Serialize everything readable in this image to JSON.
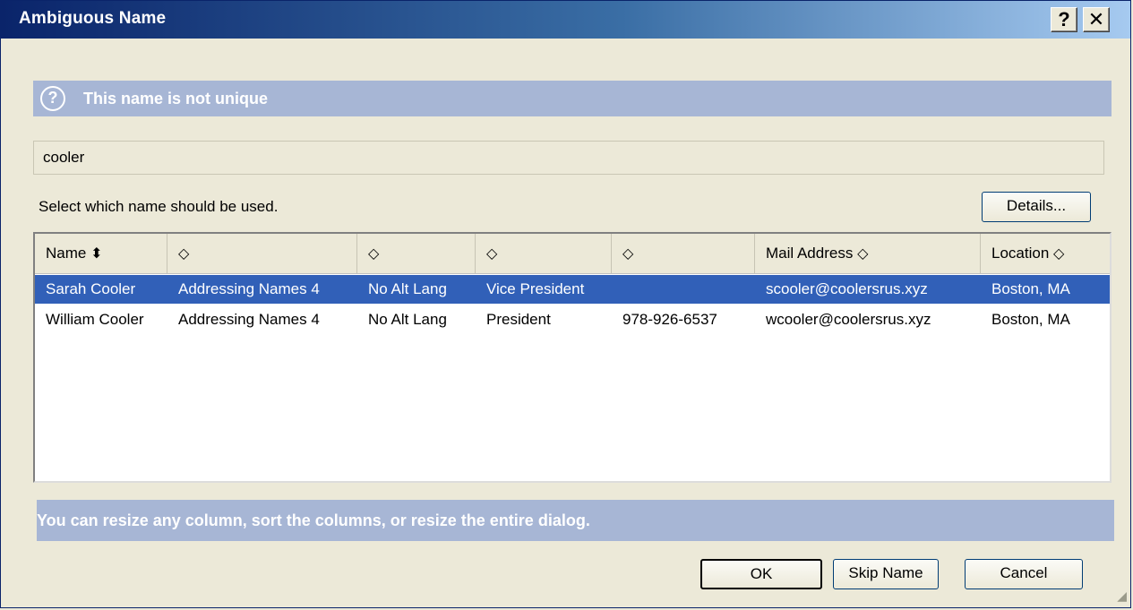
{
  "window": {
    "title": "Ambiguous Name",
    "help_label": "?",
    "close_label": "✕"
  },
  "banner": {
    "icon": "?",
    "text": "This name is not unique"
  },
  "search_value": "cooler",
  "instruction": "Select which name should be used.",
  "buttons": {
    "details": "Details...",
    "ok": "OK",
    "skip": "Skip Name",
    "cancel": "Cancel"
  },
  "table": {
    "headers": [
      {
        "label": "Name",
        "sort": "▲▼",
        "sorted": true
      },
      {
        "label": "",
        "sort": "◇"
      },
      {
        "label": "",
        "sort": "◇"
      },
      {
        "label": "",
        "sort": "◇"
      },
      {
        "label": "",
        "sort": "◇"
      },
      {
        "label": "Mail Address",
        "sort": "◇"
      },
      {
        "label": "Location",
        "sort": "◇"
      }
    ],
    "rows": [
      {
        "cells": [
          "Sarah Cooler",
          "Addressing Names 4",
          "No Alt Lang",
          "Vice President",
          "",
          "scooler@coolersrus.xyz",
          "Boston, MA"
        ],
        "selected": true
      },
      {
        "cells": [
          "William Cooler",
          "Addressing Names 4",
          "No Alt Lang",
          "President",
          "978-926-6537",
          "wcooler@coolersrus.xyz",
          "Boston, MA"
        ],
        "selected": false
      }
    ]
  },
  "footer_note": "You can resize any column, sort the columns, or resize the entire dialog.",
  "colors": {
    "title_gradient_start": "#0a246a",
    "banner_bg": "#a7b6d5",
    "selection": "#3160b8",
    "dialog_bg": "#ece9d8"
  }
}
